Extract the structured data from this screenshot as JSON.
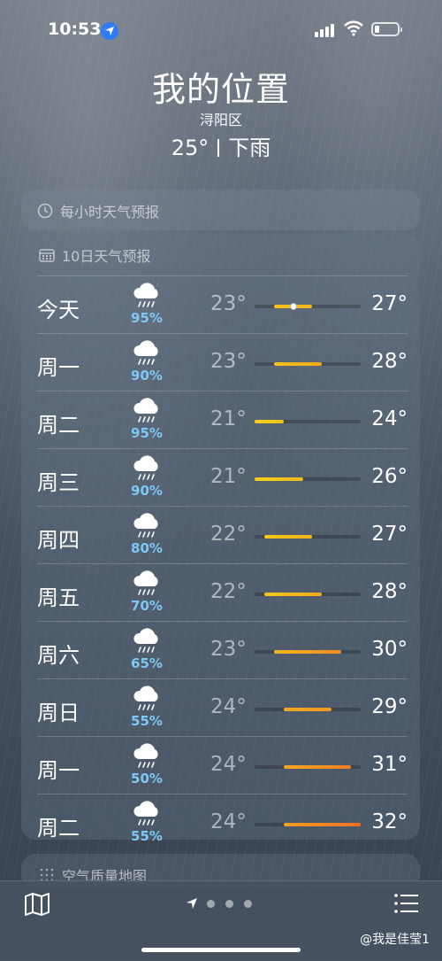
{
  "status_bar": {
    "time": "10:53"
  },
  "header": {
    "title": "我的位置",
    "district": "浔阳区",
    "temperature": "25°",
    "condition": "下雨"
  },
  "hourly_card": {
    "title": "每小时天气预报"
  },
  "forecast_card": {
    "title": "10日天气预报",
    "days": [
      {
        "day": "今天",
        "pop": "95%",
        "low": "23°",
        "high": "27°",
        "low_val": 23,
        "high_val": 27,
        "current": 25,
        "color_start": "#f5c518",
        "color_end": "#f4b21c"
      },
      {
        "day": "周一",
        "pop": "90%",
        "low": "23°",
        "high": "28°",
        "low_val": 23,
        "high_val": 28,
        "color_start": "#f5c21a",
        "color_end": "#f4a81f"
      },
      {
        "day": "周二",
        "pop": "95%",
        "low": "21°",
        "high": "24°",
        "low_val": 21,
        "high_val": 24,
        "color_start": "#f4d11a",
        "color_end": "#f5c21a"
      },
      {
        "day": "周三",
        "pop": "90%",
        "low": "21°",
        "high": "26°",
        "low_val": 21,
        "high_val": 26,
        "color_start": "#f4d11a",
        "color_end": "#f5b81b"
      },
      {
        "day": "周四",
        "pop": "80%",
        "low": "22°",
        "high": "27°",
        "low_val": 22,
        "high_val": 27,
        "color_start": "#f5c818",
        "color_end": "#f4b21c"
      },
      {
        "day": "周五",
        "pop": "70%",
        "low": "22°",
        "high": "28°",
        "low_val": 22,
        "high_val": 28,
        "color_start": "#f5c818",
        "color_end": "#f4a81f"
      },
      {
        "day": "周六",
        "pop": "65%",
        "low": "23°",
        "high": "30°",
        "low_val": 23,
        "high_val": 30,
        "color_start": "#f5b81b",
        "color_end": "#f28a25"
      },
      {
        "day": "周日",
        "pop": "55%",
        "low": "24°",
        "high": "29°",
        "low_val": 24,
        "high_val": 29,
        "color_start": "#f4a81f",
        "color_end": "#f29a23"
      },
      {
        "day": "周一",
        "pop": "50%",
        "low": "24°",
        "high": "31°",
        "low_val": 24,
        "high_val": 31,
        "color_start": "#f4a81f",
        "color_end": "#f07d28"
      },
      {
        "day": "周二",
        "pop": "55%",
        "low": "24°",
        "high": "32°",
        "low_val": 24,
        "high_val": 32,
        "color_start": "#f4a01f",
        "color_end": "#ee6e2a"
      }
    ],
    "range_min": 21,
    "range_max": 32
  },
  "air_quality_card": {
    "title": "空气质量地图"
  },
  "tab_bar": {
    "map_icon": "map-icon",
    "list_icon": "list-icon"
  },
  "watermark": "@我是佳莹1"
}
